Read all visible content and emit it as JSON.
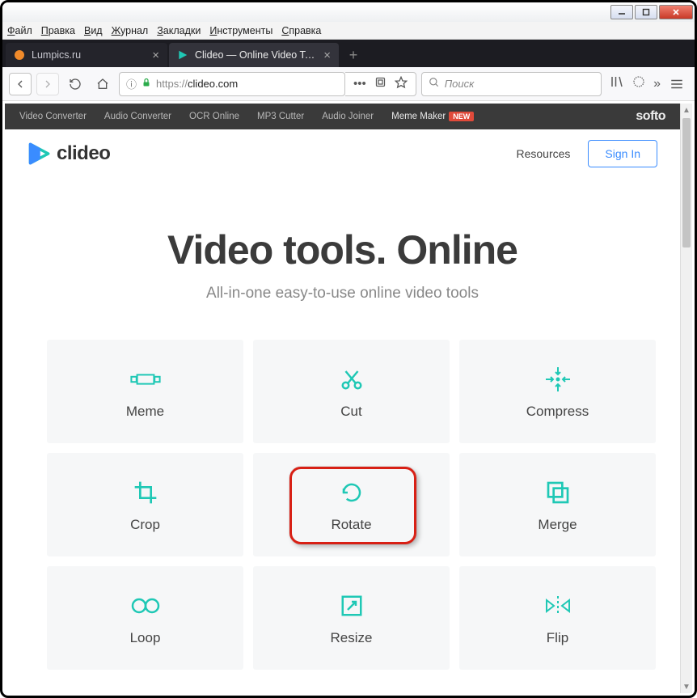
{
  "window": {
    "min": "_",
    "max": "□",
    "close": "×"
  },
  "menu": [
    "Файл",
    "Правка",
    "Вид",
    "Журнал",
    "Закладки",
    "Инструменты",
    "Справка"
  ],
  "tabs": [
    {
      "title": "Lumpics.ru",
      "active": false,
      "favicon": "orange-circle"
    },
    {
      "title": "Clideo — Online Video Tools",
      "active": true,
      "favicon": "clideo-play"
    }
  ],
  "newtab": "+",
  "addr": {
    "prefix": "https://",
    "host": "clideo.com"
  },
  "search_placeholder": "Поиск",
  "softo": {
    "links": [
      "Video Converter",
      "Audio Converter",
      "OCR Online",
      "MP3 Cutter",
      "Audio Joiner"
    ],
    "meme": "Meme Maker",
    "badge": "NEW",
    "brand": "softo"
  },
  "clideo": {
    "brand": "clideo",
    "resources": "Resources",
    "signin": "Sign In"
  },
  "hero": {
    "title": "Video tools. Online",
    "subtitle": "All-in-one easy-to-use online video tools"
  },
  "tools": [
    {
      "label": "Meme",
      "icon": "meme"
    },
    {
      "label": "Cut",
      "icon": "cut"
    },
    {
      "label": "Compress",
      "icon": "compress"
    },
    {
      "label": "Crop",
      "icon": "crop"
    },
    {
      "label": "Rotate",
      "icon": "rotate"
    },
    {
      "label": "Merge",
      "icon": "merge"
    },
    {
      "label": "Loop",
      "icon": "loop"
    },
    {
      "label": "Resize",
      "icon": "resize"
    },
    {
      "label": "Flip",
      "icon": "flip"
    }
  ]
}
